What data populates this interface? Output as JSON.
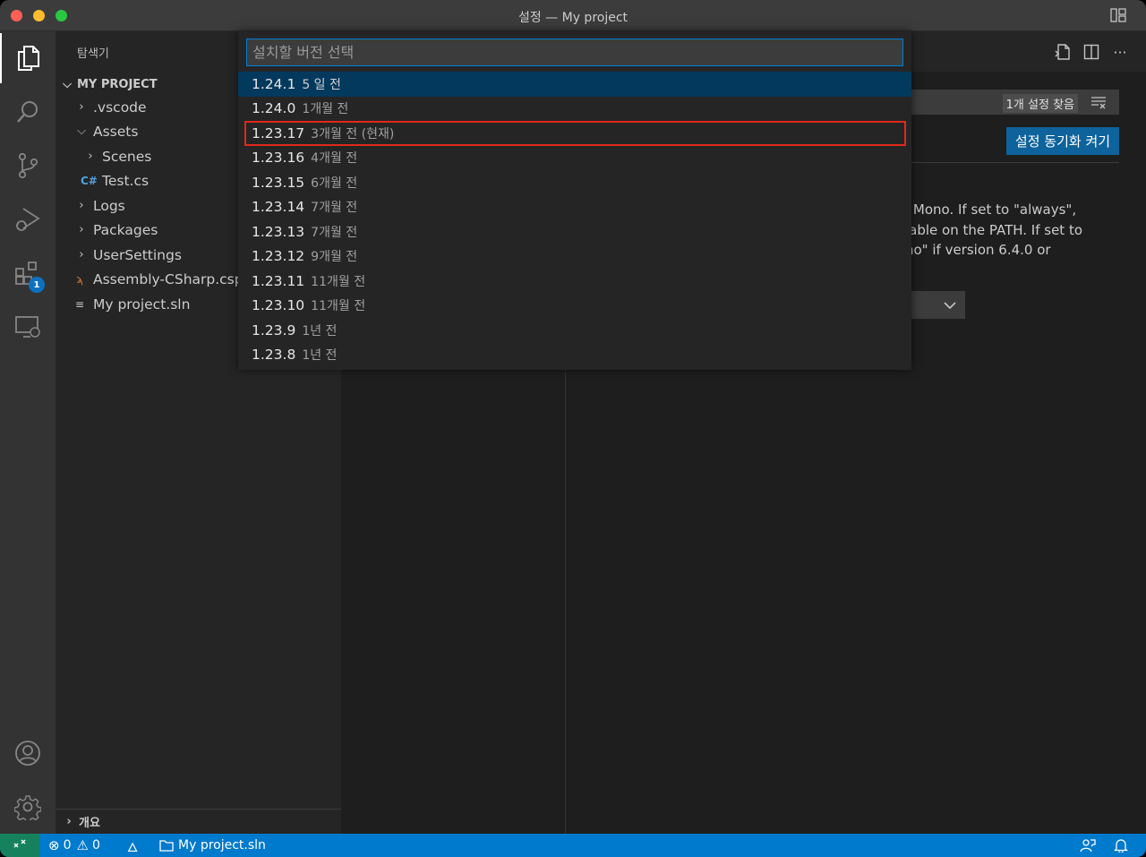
{
  "window": {
    "title": "설정 — My project"
  },
  "sidebar": {
    "title": "탐색기",
    "section": "MY PROJECT",
    "items": [
      {
        "label": ".vscode",
        "kind": "folder-collapsed"
      },
      {
        "label": "Assets",
        "kind": "folder-expanded"
      },
      {
        "label": "Scenes",
        "kind": "folder-collapsed"
      },
      {
        "label": "Test.cs",
        "kind": "csharp-file"
      },
      {
        "label": "Logs",
        "kind": "folder-collapsed"
      },
      {
        "label": "Packages",
        "kind": "folder-collapsed"
      },
      {
        "label": "UserSettings",
        "kind": "folder-collapsed"
      },
      {
        "label": "Assembly-CSharp.csproj",
        "kind": "rss-file"
      },
      {
        "label": "My project.sln",
        "kind": "text-file"
      }
    ],
    "outline": "개요"
  },
  "activity": {
    "extensions_badge": "1"
  },
  "quickpick": {
    "placeholder": "설치할 버전 선택",
    "items": [
      {
        "version": "1.24.1",
        "time": "5 일 전"
      },
      {
        "version": "1.24.0",
        "time": "1개월 전"
      },
      {
        "version": "1.23.17",
        "time": "3개월 전 (현재)"
      },
      {
        "version": "1.23.16",
        "time": "4개월 전"
      },
      {
        "version": "1.23.15",
        "time": "6개월 전"
      },
      {
        "version": "1.23.14",
        "time": "7개월 전"
      },
      {
        "version": "1.23.13",
        "time": "7개월 전"
      },
      {
        "version": "1.23.12",
        "time": "9개월 전"
      },
      {
        "version": "1.23.11",
        "time": "11개월 전"
      },
      {
        "version": "1.23.10",
        "time": "11개월 전"
      },
      {
        "version": "1.23.9",
        "time": "1년 전"
      },
      {
        "version": "1.23.8",
        "time": "1년 전"
      }
    ]
  },
  "settings": {
    "found_count": "1개 설정 찾음",
    "sync_button": "설정 동기화 켜기",
    "desc_lines": [
      "l Mono. If set to \"always\",",
      "lable on the PATH. If set to",
      "no\" if version 6.4.0 or"
    ]
  },
  "statusbar": {
    "errors": "0",
    "warnings": "0",
    "project": "My project.sln"
  },
  "colors": {
    "accent": "#007acc",
    "selection": "#04395e",
    "highlight_box": "#e0291b",
    "remote": "#16825d"
  }
}
